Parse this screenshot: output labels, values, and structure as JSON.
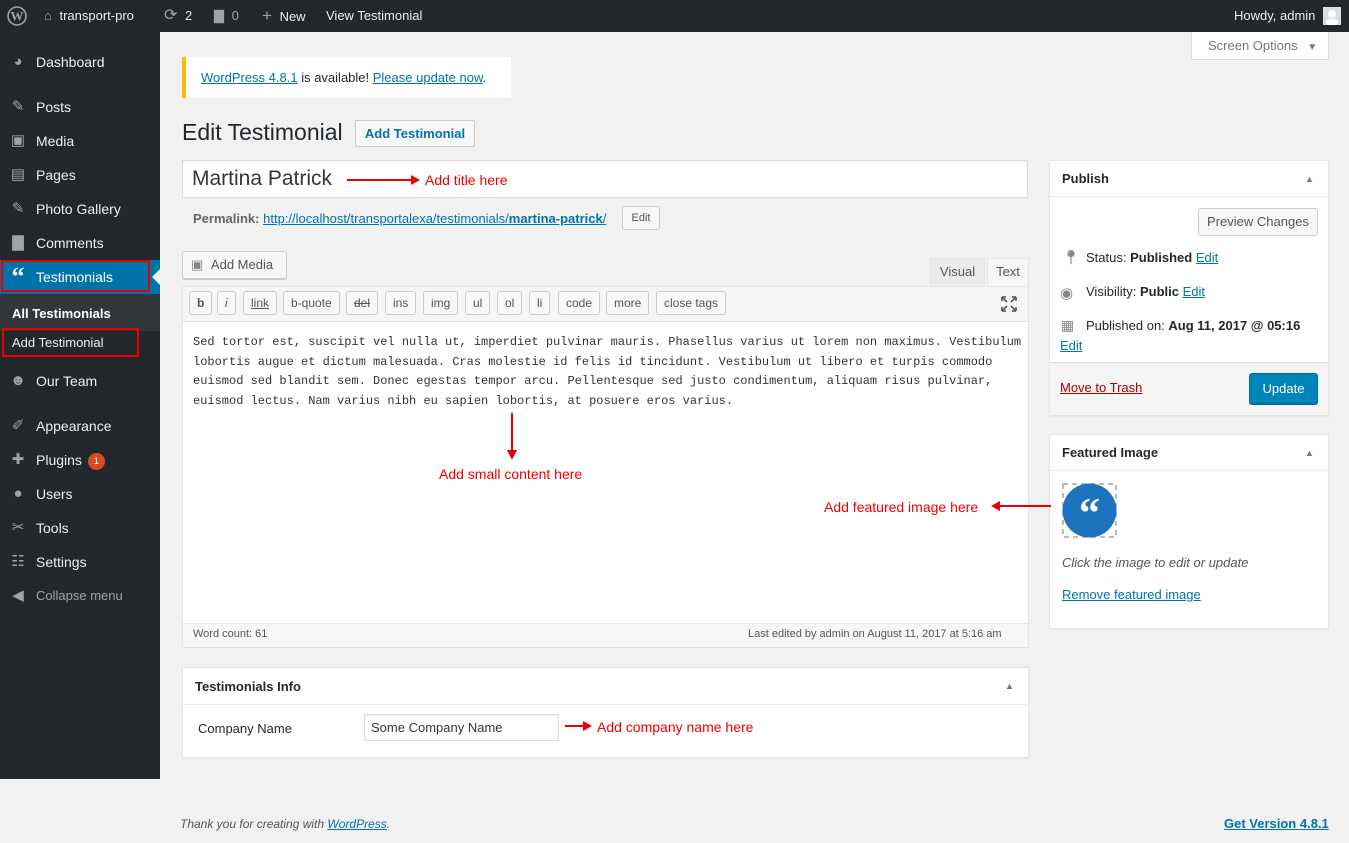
{
  "adminbar": {
    "site_name": "transport-pro",
    "updates": "2",
    "comments": "0",
    "new_label": "New",
    "view_label": "View Testimonial",
    "howdy": "Howdy, admin"
  },
  "screen_options": "Screen Options",
  "sidebar": {
    "items": [
      {
        "label": "Dashboard",
        "icon": "dashboard-icon"
      },
      {
        "label": "Posts",
        "icon": "pin-icon"
      },
      {
        "label": "Media",
        "icon": "media-icon"
      },
      {
        "label": "Pages",
        "icon": "pages-icon"
      },
      {
        "label": "Photo Gallery",
        "icon": "pin-icon"
      },
      {
        "label": "Comments",
        "icon": "comment-icon"
      },
      {
        "label": "Testimonials",
        "icon": "quote-icon"
      },
      {
        "label": "Our Team",
        "icon": "team-icon"
      },
      {
        "label": "Appearance",
        "icon": "brush-icon"
      },
      {
        "label": "Plugins",
        "icon": "plug-icon",
        "badge": "1"
      },
      {
        "label": "Users",
        "icon": "user-icon"
      },
      {
        "label": "Tools",
        "icon": "wrench-icon"
      },
      {
        "label": "Settings",
        "icon": "settings-icon"
      },
      {
        "label": "Collapse menu",
        "icon": "collapse-icon"
      }
    ],
    "submenu": [
      "All Testimonials",
      "Add Testimonial"
    ]
  },
  "notice": {
    "version_link": "WordPress 4.8.1",
    "middle": " is available! ",
    "update_link": "Please update now",
    "end": "."
  },
  "page": {
    "title": "Edit Testimonial",
    "add_button": "Add Testimonial"
  },
  "post": {
    "title": "Martina Patrick",
    "permalink_label": "Permalink:",
    "permalink_base": "http://localhost/transportalexa/testimonials/",
    "permalink_slug": "martina-patrick",
    "permalink_end": "/",
    "edit_label": "Edit"
  },
  "editor": {
    "add_media": "Add Media",
    "tab_visual": "Visual",
    "tab_text": "Text",
    "quicktags": [
      "b",
      "i",
      "link",
      "b-quote",
      "del",
      "ins",
      "img",
      "ul",
      "ol",
      "li",
      "code",
      "more",
      "close tags"
    ],
    "content": [
      "Sed tortor est, suscipit vel nulla ut, imperdiet pulvinar mauris. Phasellus varius ut lorem non maximus. Vestibulum",
      "lobortis augue et dictum malesuada. Cras molestie id felis id tincidunt. Vestibulum ut libero et turpis commodo",
      "euismod sed blandit sem. Donec egestas tempor arcu. Pellentesque sed justo condimentum, aliquam risus pulvinar,",
      "euismod lectus. Nam varius nibh eu sapien lobortis, at posuere eros varius."
    ],
    "word_count": "Word count: 61",
    "last_edited": "Last edited by admin on August 11, 2017 at 5:16 am"
  },
  "annotations": {
    "title": "Add title here",
    "content": "Add small content here",
    "featured": "Add featured image here",
    "company": "Add company name here"
  },
  "testimonials_info": {
    "title": "Testimonials Info",
    "company_label": "Company Name",
    "company_value": "Some Company Name"
  },
  "publish": {
    "title": "Publish",
    "preview": "Preview Changes",
    "status_label": "Status:",
    "status_value": "Published",
    "visibility_label": "Visibility:",
    "visibility_value": "Public",
    "published_label": "Published on:",
    "published_value": "Aug 11, 2017 @ 05:16",
    "edit": "Edit",
    "trash": "Move to Trash",
    "update": "Update"
  },
  "featured": {
    "title": "Featured Image",
    "hint": "Click the image to edit or update",
    "remove": "Remove featured image"
  },
  "footer": {
    "thanks": "Thank you for creating with ",
    "wp_link": "WordPress",
    "end": ".",
    "version": "Get Version 4.8.1"
  },
  "colors": {
    "accent": "#0073aa",
    "sidebar": "#23282d",
    "annotation": "#ee0000",
    "warning": "#ffb900"
  }
}
